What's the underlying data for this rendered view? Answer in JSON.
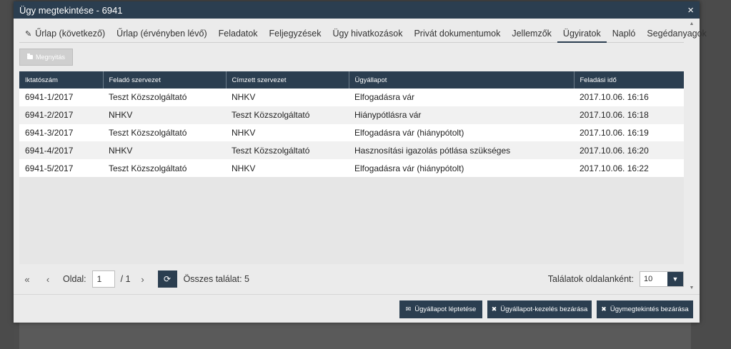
{
  "window": {
    "title": "Ügy megtekintése - 6941",
    "close": "×"
  },
  "tabs": [
    {
      "label": "Űrlap (következő)",
      "icon": "edit-icon"
    },
    {
      "label": "Űrlap (érvényben lévő)"
    },
    {
      "label": "Feladatok"
    },
    {
      "label": "Feljegyzések"
    },
    {
      "label": "Ügy hivatkozások"
    },
    {
      "label": "Privát dokumentumok"
    },
    {
      "label": "Jellemzők"
    },
    {
      "label": "Ügyiratok",
      "active": true
    },
    {
      "label": "Napló"
    },
    {
      "label": "Segédanyagok"
    }
  ],
  "toolbar": {
    "open_label": "Megnyitás"
  },
  "grid": {
    "columns": [
      "Iktatószám",
      "Feladó szervezet",
      "Címzett szervezet",
      "Ügyállapot",
      "Feladási idő"
    ],
    "rows": [
      [
        "6941-1/2017",
        "Teszt Közszolgáltató",
        "NHKV",
        "Elfogadásra vár",
        "2017.10.06. 16:16"
      ],
      [
        "6941-2/2017",
        "NHKV",
        "Teszt Közszolgáltató",
        "Hiánypótlásra vár",
        "2017.10.06. 16:18"
      ],
      [
        "6941-3/2017",
        "Teszt Közszolgáltató",
        "NHKV",
        "Elfogadásra vár (hiánypótolt)",
        "2017.10.06. 16:19"
      ],
      [
        "6941-4/2017",
        "NHKV",
        "Teszt Közszolgáltató",
        "Hasznosítási igazolás pótlása szükséges",
        "2017.10.06. 16:20"
      ],
      [
        "6941-5/2017",
        "Teszt Közszolgáltató",
        "NHKV",
        "Elfogadásra vár (hiánypótolt)",
        "2017.10.06. 16:22"
      ]
    ]
  },
  "pager": {
    "first": "«",
    "prev": "‹",
    "next": "›",
    "page_label": "Oldal:",
    "page_value": "1",
    "page_total": "/ 1",
    "total_label": "Összes találat: 5",
    "per_page_label": "Találatok oldalanként:",
    "per_page_value": "10"
  },
  "footer": {
    "advance_label": "Ügyállapot léptetése",
    "close_handling_label": "Ügyállapot-kezelés bezárása",
    "close_view_label": "Ügymegtekintés bezárása"
  },
  "colors": {
    "accent": "#2b3e50",
    "modal_bg": "#ebebeb"
  }
}
